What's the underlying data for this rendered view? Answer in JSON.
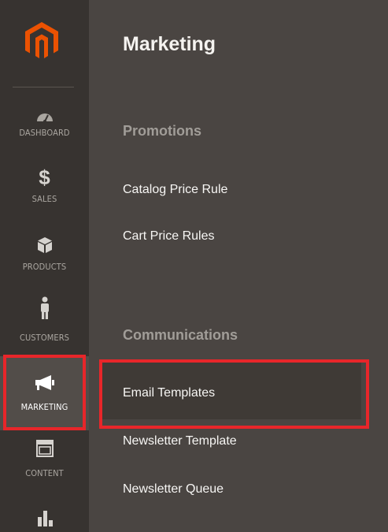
{
  "sidebar": {
    "logo": "magento-logo-icon",
    "items": [
      {
        "id": "dashboard",
        "label": "DASHBOARD",
        "icon": "gauge-icon"
      },
      {
        "id": "sales",
        "label": "SALES",
        "icon": "dollar-icon"
      },
      {
        "id": "products",
        "label": "PRODUCTS",
        "icon": "cube-icon"
      },
      {
        "id": "customers",
        "label": "CUSTOMERS",
        "icon": "person-icon"
      },
      {
        "id": "marketing",
        "label": "MARKETING",
        "icon": "megaphone-icon",
        "active": true
      },
      {
        "id": "content",
        "label": "CONTENT",
        "icon": "layout-icon"
      },
      {
        "id": "reports",
        "label": "",
        "icon": "bar-chart-icon"
      }
    ]
  },
  "panel": {
    "title": "Marketing",
    "sections": [
      {
        "title": "Promotions",
        "links": [
          "Catalog Price Rule",
          "Cart Price Rules"
        ]
      },
      {
        "title": "Communications",
        "links": [
          "Email Templates",
          "Newsletter Template",
          "Newsletter Queue"
        ]
      }
    ],
    "selected_link": "Email Templates"
  },
  "colors": {
    "sidebar_bg": "#373330",
    "panel_bg": "#4a4542",
    "accent_orange": "#eb5202",
    "highlight_red": "#e8262a"
  }
}
